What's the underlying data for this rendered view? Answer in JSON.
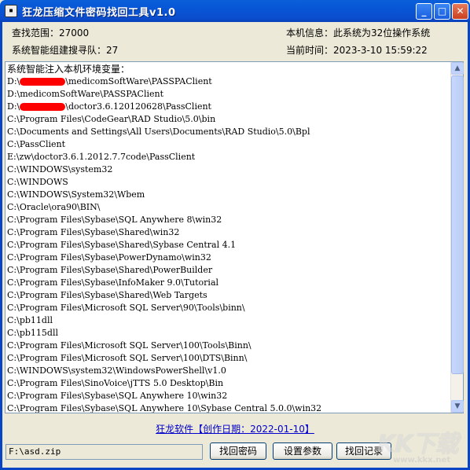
{
  "window": {
    "title": "狂龙压缩文件密码找回工具v1.0",
    "buttons": {
      "minimize": "_",
      "maximize": "□",
      "close": "✕"
    },
    "icon": "app-icon"
  },
  "info": {
    "search_range": "查找范围：27000",
    "system_info": "本机信息：此系统为32位操作系统",
    "team": "系统智能组建搜寻队：27",
    "current_time": "当前时间：2023-3-10  15:59:22"
  },
  "log": {
    "header": "系统智能注入本机环境变量：",
    "lines": [
      {
        "pre": "D:\\",
        "redact": true,
        "post": "\\medicomSoftWare\\PASSPAClient"
      },
      {
        "pre": "D:\\medicomSoftWare\\PASSPAClient",
        "redact": false,
        "post": ""
      },
      {
        "pre": "D:\\",
        "redact": true,
        "post": "\\doctor3.6.120120628\\PassClient"
      },
      {
        "pre": "C:\\Program Files\\CodeGear\\RAD Studio\\5.0\\bin",
        "redact": false,
        "post": ""
      },
      {
        "pre": "C:\\Documents and Settings\\All Users\\Documents\\RAD Studio\\5.0\\Bpl",
        "redact": false,
        "post": ""
      },
      {
        "pre": "C:\\PassClient",
        "redact": false,
        "post": ""
      },
      {
        "pre": "E:\\zw\\doctor3.6.1.2012.7.7code\\PassClient",
        "redact": false,
        "post": ""
      },
      {
        "pre": "C:\\WINDOWS\\system32",
        "redact": false,
        "post": ""
      },
      {
        "pre": "C:\\WINDOWS",
        "redact": false,
        "post": ""
      },
      {
        "pre": "C:\\WINDOWS\\System32\\Wbem",
        "redact": false,
        "post": ""
      },
      {
        "pre": "C:\\Oracle\\ora90\\BIN\\",
        "redact": false,
        "post": ""
      },
      {
        "pre": "C:\\Program Files\\Sybase\\SQL Anywhere 8\\win32",
        "redact": false,
        "post": ""
      },
      {
        "pre": "C:\\Program Files\\Sybase\\Shared\\win32",
        "redact": false,
        "post": ""
      },
      {
        "pre": "C:\\Program Files\\Sybase\\Shared\\Sybase Central 4.1",
        "redact": false,
        "post": ""
      },
      {
        "pre": "C:\\Program Files\\Sybase\\PowerDynamo\\win32",
        "redact": false,
        "post": ""
      },
      {
        "pre": "C:\\Program Files\\Sybase\\Shared\\PowerBuilder",
        "redact": false,
        "post": ""
      },
      {
        "pre": "C:\\Program Files\\Sybase\\InfoMaker 9.0\\Tutorial",
        "redact": false,
        "post": ""
      },
      {
        "pre": "C:\\Program Files\\Sybase\\Shared\\Web Targets",
        "redact": false,
        "post": ""
      },
      {
        "pre": "C:\\Program Files\\Microsoft SQL Server\\90\\Tools\\binn\\",
        "redact": false,
        "post": ""
      },
      {
        "pre": "C:\\pb11dll",
        "redact": false,
        "post": ""
      },
      {
        "pre": "C:\\pb115dll",
        "redact": false,
        "post": ""
      },
      {
        "pre": "C:\\Program Files\\Microsoft SQL Server\\100\\Tools\\Binn\\",
        "redact": false,
        "post": ""
      },
      {
        "pre": "C:\\Program Files\\Microsoft SQL Server\\100\\DTS\\Binn\\",
        "redact": false,
        "post": ""
      },
      {
        "pre": "C:\\WINDOWS\\system32\\WindowsPowerShell\\v1.0",
        "redact": false,
        "post": ""
      },
      {
        "pre": "C:\\Program Files\\SinoVoice\\jTTS 5.0 Desktop\\Bin",
        "redact": false,
        "post": ""
      },
      {
        "pre": "C:\\Program Files\\Sybase\\SQL Anywhere 10\\win32",
        "redact": false,
        "post": ""
      },
      {
        "pre": "C:\\Program Files\\Sybase\\SQL Anywhere 10\\Sybase Central 5.0.0\\win32",
        "redact": false,
        "post": ""
      }
    ]
  },
  "footer": {
    "author_link": "狂龙软件【创作日期：2022-01-10】",
    "path_value": "F:\\asd.zip",
    "find_password": "找回密码",
    "settings": "设置参数",
    "records": "找回记录"
  },
  "watermark": {
    "text": "KK下载",
    "url": "www.kkx.net"
  },
  "colors": {
    "titlebar": "#0a5fd8",
    "link": "#0000cc",
    "redaction": "#ff0000",
    "background": "#ece9d8"
  }
}
